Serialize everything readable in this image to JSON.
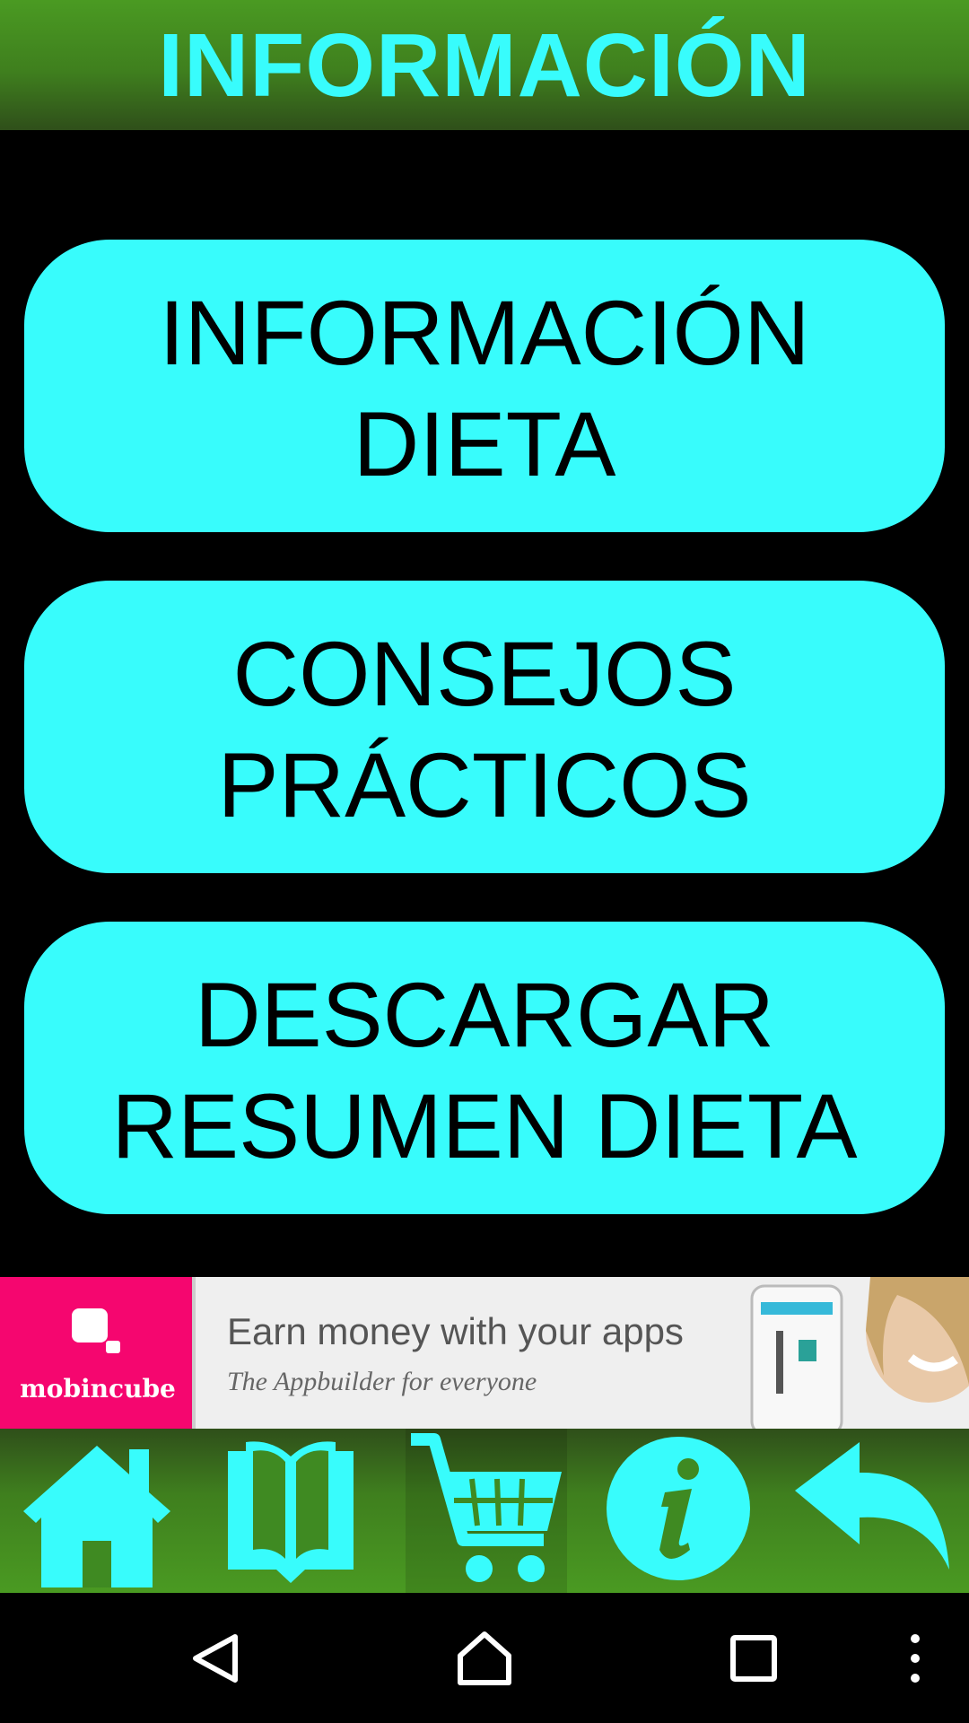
{
  "header": {
    "title": "INFORMACIÓN"
  },
  "menu": [
    {
      "line1": "INFORMACIÓN",
      "line2": "DIETA"
    },
    {
      "line1": "CONSEJOS",
      "line2": "PRÁCTICOS"
    },
    {
      "line1": "DESCARGAR",
      "line2": "RESUMEN DIETA"
    }
  ],
  "ad": {
    "brand": "mobincube",
    "headline": "Earn money with your apps",
    "subline": "The Appbuilder for everyone"
  },
  "toolbar": {
    "icons": [
      "home-icon",
      "book-icon",
      "cart-icon",
      "info-icon",
      "back-arrow-icon"
    ]
  },
  "colors": {
    "accent": "#38fcfc",
    "header_green": "#3f7f1e",
    "background": "#000000",
    "ad_brand": "#f5066f"
  },
  "navbar": {
    "icons": [
      "nav-back-icon",
      "nav-home-icon",
      "nav-recents-icon",
      "nav-overflow-icon"
    ]
  }
}
